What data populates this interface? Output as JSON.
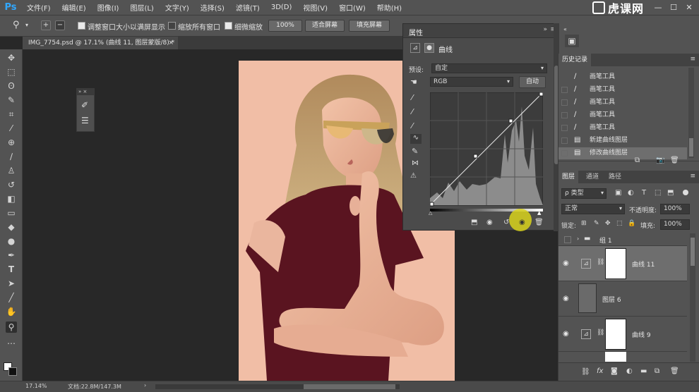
{
  "app": {
    "logo": "Ps",
    "menu": [
      "文件(F)",
      "编辑(E)",
      "图像(I)",
      "图层(L)",
      "文字(Y)",
      "选择(S)",
      "滤镜(T)",
      "3D(D)",
      "视图(V)",
      "窗口(W)",
      "帮助(H)"
    ],
    "brand_text": "虎课网"
  },
  "options_bar": {
    "resize_windows_label": "调整窗口大小以满屏显示",
    "zoom_all_label": "缩放所有窗口",
    "scrubby_zoom_label": "细微缩放",
    "zoom_value": "100%",
    "fit_screen_label": "适合屏幕",
    "fill_screen_label": "填充屏幕"
  },
  "document": {
    "tab_title": "IMG_7754.psd @ 17.1% (曲线 11, 图层蒙版/8) *",
    "close_icon": "close-icon"
  },
  "properties": {
    "title": "属性",
    "adjustment_name": "曲线",
    "preset_label": "预设:",
    "preset_value": "自定",
    "channel_value": "RGB",
    "auto_label": "自动"
  },
  "history": {
    "tab_label": "历史记录",
    "items": [
      {
        "icon": "brush-icon",
        "label": "画笔工具"
      },
      {
        "icon": "brush-icon",
        "label": "画笔工具"
      },
      {
        "icon": "brush-icon",
        "label": "画笔工具"
      },
      {
        "icon": "brush-icon",
        "label": "画笔工具"
      },
      {
        "icon": "brush-icon",
        "label": "画笔工具"
      },
      {
        "icon": "layer-new-icon",
        "label": "新建曲线图层"
      },
      {
        "icon": "layer-edit-icon",
        "label": "修改曲线图层"
      }
    ]
  },
  "layers": {
    "tabs": [
      "图层",
      "通道",
      "路径"
    ],
    "filter_kind": "类型",
    "blend_mode": "正常",
    "opacity_label": "不透明度:",
    "opacity_value": "100%",
    "lock_label": "锁定:",
    "fill_label": "填充:",
    "fill_value": "100%",
    "items": [
      {
        "name": "组 1",
        "type": "group"
      },
      {
        "name": "曲线 11",
        "type": "adjustment"
      },
      {
        "name": "图层 6",
        "type": "pixel"
      },
      {
        "name": "曲线 9",
        "type": "adjustment"
      }
    ]
  },
  "status": {
    "zoom": "17.14%",
    "doc_size": "文档:22.8M/147.3M"
  },
  "colors": {
    "accent": "#31a8ff",
    "panel_bg": "#535353",
    "photo_bg": "#f1bea6",
    "dress": "#5a1420",
    "cursor_highlight": "#d8d21c"
  }
}
